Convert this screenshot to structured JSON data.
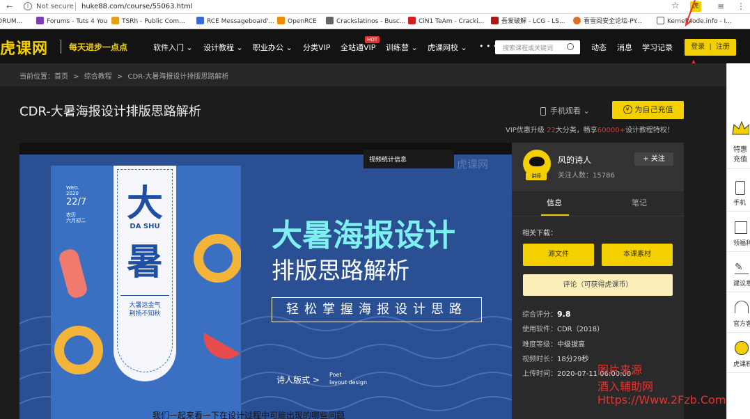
{
  "browser": {
    "security": "Not secure",
    "url": "huke88.com/course/55063.html",
    "bookmarks": [
      {
        "label": "ORUM...",
        "color": "#999999"
      },
      {
        "label": "Forums - Tuts 4 You",
        "color": "#7a3fb0"
      },
      {
        "label": "TSRh - Public Com...",
        "color": "#e0a020"
      },
      {
        "label": "RCE Messageboard'...",
        "color": "#3a6ad6"
      },
      {
        "label": "OpenRCE",
        "color": "#f08a00"
      },
      {
        "label": "Crackslatinos - Busc...",
        "color": "#666666"
      },
      {
        "label": "CiN1 TeAm - Cracki...",
        "color": "#d02020"
      },
      {
        "label": "吾爱破解 - LCG - LS...",
        "color": "#b01818"
      },
      {
        "label": "看雪阅安全论坛-PY...",
        "color": "#e07020"
      },
      {
        "label": "KernelMode.info - I...",
        "color": "#555555"
      }
    ]
  },
  "header": {
    "logo": "虎课网",
    "slogan": "每天进步一点点",
    "nav": [
      {
        "label": "软件入门",
        "caret": true
      },
      {
        "label": "设计教程",
        "caret": true
      },
      {
        "label": "职业办公",
        "caret": true
      },
      {
        "label": "分类VIP",
        "caret": false
      },
      {
        "label": "全站通VIP",
        "caret": false,
        "badge": "HOT"
      },
      {
        "label": "训练营",
        "caret": true
      },
      {
        "label": "虎课网校",
        "caret": true
      }
    ],
    "more": "• • •",
    "search_placeholder": "搜索课程或关键词",
    "links": [
      "动态",
      "消息",
      "学习记录"
    ],
    "login": "登录",
    "register": "注册"
  },
  "breadcrumb": {
    "prefix": "当前位置：",
    "items": [
      "首页",
      "综合教程",
      "CDR-大暑海报设计排版思路解析"
    ],
    "sep": ">"
  },
  "course": {
    "title": "CDR-大暑海报设计排版思路解析",
    "mobile_watch": "手机观看",
    "recharge": "为自己充值",
    "vip_promo": {
      "p1": "VIP优惠升级 ",
      "n1": "22",
      "p2": "大分类，畅享",
      "n2": "60000+",
      "p3": "设计教程特权！"
    }
  },
  "player": {
    "stats_label": "视频统计信息",
    "watermark": "虎课网",
    "poster": {
      "date_label": "WED.",
      "year": "2020",
      "date": "22/7",
      "lunar1": "农历",
      "lunar2": "六月初二",
      "big1": "大",
      "pinyin": "DA SHU",
      "big2": "暑",
      "caption1": "大暑运金气",
      "caption2": "荆扬不知秋"
    },
    "headline1": "大暑海报设计",
    "headline2": "排版思路解析",
    "tagline": "轻松掌握海报设计思路",
    "series": "诗人版式 >",
    "series_en1": "Poet",
    "series_en2": "layout design",
    "subtitle": "我们一起来看一下在设计过程中可能出现的哪些问题"
  },
  "teacher": {
    "name": "风的诗人",
    "badge": "讲师",
    "followers_label": "关注人数：",
    "followers": "15786",
    "follow": "+ 关注"
  },
  "tabs": [
    {
      "label": "信息",
      "active": true
    },
    {
      "label": "笔记",
      "active": false
    }
  ],
  "downloads": {
    "label": "相关下载：",
    "source": "源文件",
    "material": "本课素材",
    "comment": "评论（可获得虎课币）"
  },
  "info": {
    "rating_label": "综合评分：",
    "rating": "9.8",
    "software_label": "使用软件：",
    "software": "CDR（2018）",
    "level_label": "难度等级：",
    "level": "中级拔高",
    "duration_label": "视频时长：",
    "duration": "18分29秒",
    "upload_label": "上传时间：",
    "upload": "2020-07-11 06:00:00"
  },
  "watermark_text": {
    "line1": "图片来源",
    "line2": "酒入辅助网",
    "line3": "Https://Www.2Fzb.Com"
  },
  "sidebar": {
    "items": [
      {
        "label": "特惠充值",
        "icon": "crown-icon"
      },
      {
        "label": "手机",
        "icon": "mobile-icon"
      },
      {
        "label": "领福利",
        "icon": "gift-icon"
      },
      {
        "label": "建议意",
        "icon": "edit-icon"
      },
      {
        "label": "官方客",
        "icon": "headset-icon"
      },
      {
        "label": "虎课积",
        "icon": "coin-icon"
      }
    ]
  },
  "colors": {
    "brand_yellow": "#f5d000",
    "header_bg": "#131313",
    "player_blue": "#2b4f93",
    "accent_red": "#e8312f"
  }
}
